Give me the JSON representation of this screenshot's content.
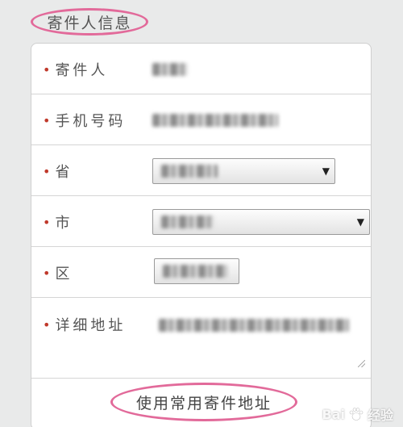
{
  "section": {
    "title": "寄件人信息"
  },
  "form": {
    "fields": [
      {
        "label": "寄件人"
      },
      {
        "label": "手机号码"
      },
      {
        "label": "省"
      },
      {
        "label": "市"
      },
      {
        "label": "区"
      },
      {
        "label": "详细地址"
      }
    ],
    "required_mark": "•"
  },
  "action": {
    "use_common_address": "使用常用寄件地址"
  },
  "watermark": {
    "text_left": "Bai",
    "text_right": "经验"
  },
  "colors": {
    "highlight_oval": "#e26a9a",
    "required": "#c0392b",
    "card_bg": "#ffffff",
    "page_bg": "#e9eaea"
  }
}
